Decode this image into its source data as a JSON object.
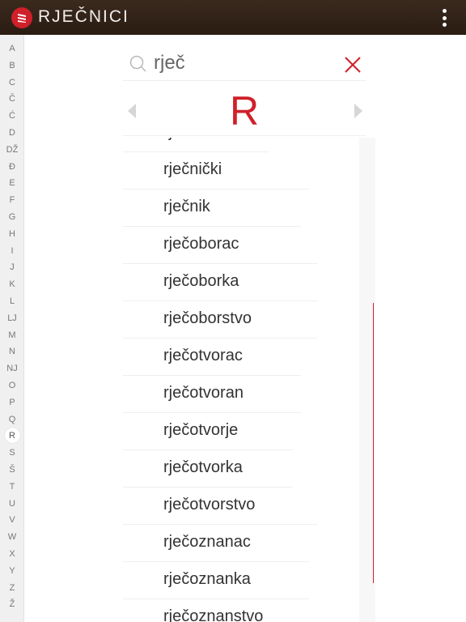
{
  "app": {
    "title": "RJEČNICI",
    "accent": "#d0202a"
  },
  "alphabet": [
    "A",
    "B",
    "C",
    "Č",
    "Ć",
    "D",
    "DŽ",
    "Đ",
    "E",
    "F",
    "G",
    "H",
    "I",
    "J",
    "K",
    "L",
    "LJ",
    "M",
    "N",
    "NJ",
    "O",
    "P",
    "Q",
    "R",
    "S",
    "Š",
    "T",
    "U",
    "V",
    "W",
    "X",
    "Y",
    "Z",
    "Ž"
  ],
  "alphabet_selected": "R",
  "search": {
    "value": "rječ"
  },
  "current_letter": "R",
  "entries": [
    "rječkati se",
    "rječnički",
    "rječnik",
    "rječoborac",
    "rječoborka",
    "rječoborstvo",
    "rječotvorac",
    "rječotvoran",
    "rječotvorje",
    "rječotvorka",
    "rječotvorstvo",
    "rječoznanac",
    "rječoznanka",
    "rječoznanstvo"
  ]
}
